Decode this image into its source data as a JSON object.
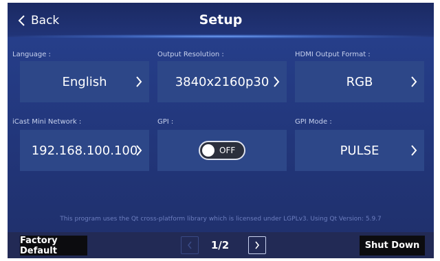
{
  "header": {
    "back_label": "Back",
    "title": "Setup"
  },
  "settings": [
    {
      "label": "Language :",
      "value": "English"
    },
    {
      "label": "Output Resolution :",
      "value": "3840x2160p30"
    },
    {
      "label": "HDMI Output Format :",
      "value": "RGB"
    },
    {
      "label": "iCast Mini  Network :",
      "value": "192.168.100.100"
    },
    {
      "label": "GPI :",
      "toggle_state": "OFF"
    },
    {
      "label": "GPI Mode :",
      "value": "PULSE"
    }
  ],
  "license_text": "This program uses the Qt cross-platform library which is licensed under LGPLv3. Using Qt Version: 5.9.7",
  "footer": {
    "factory_default_label": "Factory Default",
    "page_indicator": "1/2",
    "shut_down_label": "Shut Down"
  },
  "colors": {
    "background": "#22367a",
    "tile": "#2d4788",
    "footer": "#222a55",
    "footer_button": "#0c0c0f",
    "header_glow": "#78aaff"
  },
  "icons": {
    "back": "chevron-left-icon",
    "tile_arrow": "chevron-right-icon",
    "prev_page": "chevron-left-icon",
    "next_page": "chevron-right-icon"
  }
}
